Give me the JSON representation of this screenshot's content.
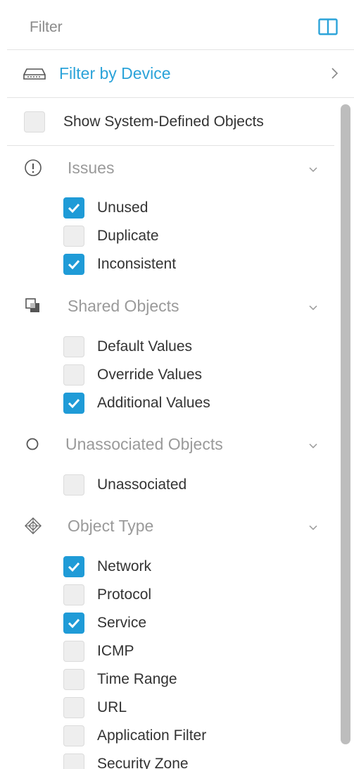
{
  "header": {
    "title": "Filter",
    "collapse_icon": "panel-collapse-icon"
  },
  "device_filter": {
    "label": "Filter by Device",
    "icon": "device-icon",
    "accent_color": "#2ba3d9"
  },
  "system_objects": {
    "label": "Show System-Defined Objects",
    "checked": false
  },
  "sections": [
    {
      "title": "Issues",
      "icon": "exclamation-circle-icon",
      "items": [
        {
          "label": "Unused",
          "checked": true
        },
        {
          "label": "Duplicate",
          "checked": false
        },
        {
          "label": "Inconsistent",
          "checked": true
        }
      ]
    },
    {
      "title": "Shared Objects",
      "icon": "shared-objects-icon",
      "items": [
        {
          "label": "Default Values",
          "checked": false
        },
        {
          "label": "Override Values",
          "checked": false
        },
        {
          "label": "Additional Values",
          "checked": true
        }
      ]
    },
    {
      "title": "Unassociated Objects",
      "icon": "circle-icon",
      "items": [
        {
          "label": "Unassociated",
          "checked": false
        }
      ]
    },
    {
      "title": "Object Type",
      "icon": "object-type-icon",
      "items": [
        {
          "label": "Network",
          "checked": true
        },
        {
          "label": "Protocol",
          "checked": false
        },
        {
          "label": "Service",
          "checked": true
        },
        {
          "label": "ICMP",
          "checked": false
        },
        {
          "label": "Time Range",
          "checked": false
        },
        {
          "label": "URL",
          "checked": false
        },
        {
          "label": "Application Filter",
          "checked": false
        },
        {
          "label": "Security Zone",
          "checked": false
        }
      ]
    }
  ],
  "colors": {
    "checkbox_checked": "#1f9bd7",
    "checkbox_unchecked": "#eeeeee"
  }
}
